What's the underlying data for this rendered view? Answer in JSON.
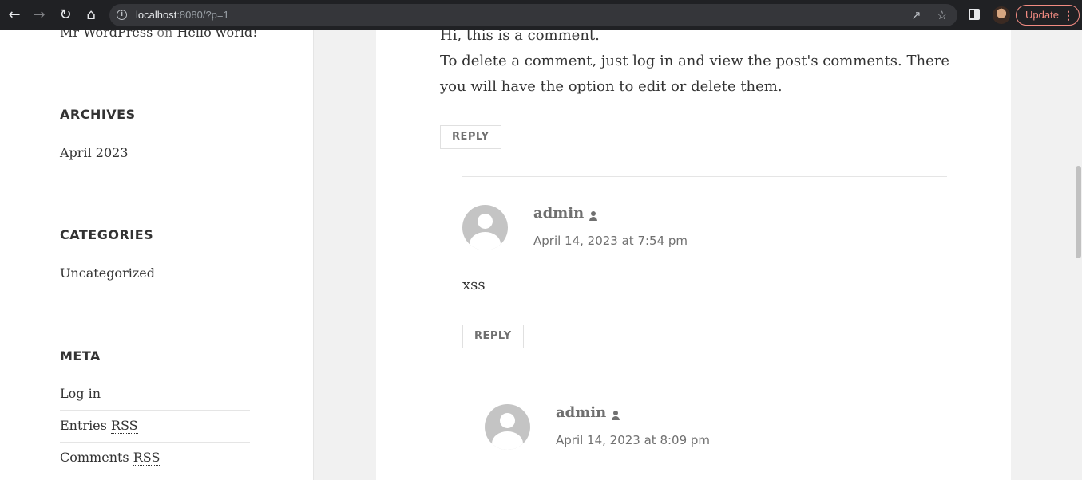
{
  "browser": {
    "url_host": "localhost",
    "url_rest": ":8080/?p=1",
    "update_label": "Update"
  },
  "sidebar": {
    "recent_comment": {
      "author": "Mr WordPress",
      "on": "on",
      "post": "Hello world!"
    },
    "archives": {
      "title": "ARCHIVES",
      "items": [
        "April 2023"
      ]
    },
    "categories": {
      "title": "CATEGORIES",
      "items": [
        "Uncategorized"
      ]
    },
    "meta": {
      "title": "META",
      "login": "Log in",
      "entries_prefix": "Entries",
      "comments_prefix": "Comments",
      "rss": "RSS"
    }
  },
  "comments": {
    "top": {
      "line1": "Hi, this is a comment.",
      "line2": "To delete a comment, just log in and view the post's comments. There you will have the option to edit or delete them.",
      "reply": "REPLY"
    },
    "reply1": {
      "author": "admin",
      "date": "April 14, 2023 at 7:54 pm",
      "body": "xss",
      "reply": "REPLY"
    },
    "reply2": {
      "author": "admin",
      "date": "April 14, 2023 at 8:09 pm"
    }
  }
}
